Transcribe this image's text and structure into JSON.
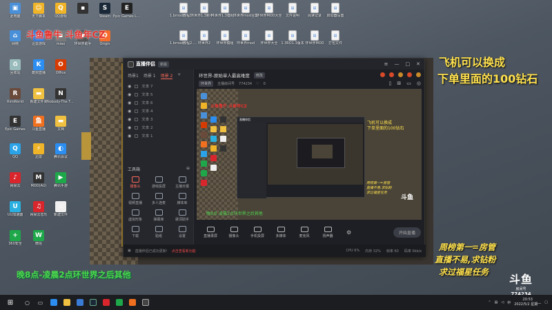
{
  "desktop_icons": [
    {
      "label": "此电脑",
      "color": "#4a90d9",
      "glyph": "▣"
    },
    {
      "label": "天下脚本",
      "color": "#f0b429",
      "glyph": "☺"
    },
    {
      "label": "QQ游戏",
      "color": "#f0b429",
      "glyph": "Q"
    },
    {
      "label": "",
      "color": "#333",
      "glyph": "▪"
    },
    {
      "label": "Steam",
      "color": "#1b2838",
      "glyph": "S"
    },
    {
      "label": "Epic Games Launcher",
      "color": "#222",
      "glyph": "E"
    },
    {
      "label": "网络",
      "color": "#4a90d9",
      "glyph": "⌂"
    },
    {
      "label": "迅雷游戏",
      "color": "#3a7bd5",
      "glyph": "▶"
    },
    {
      "label": "miao",
      "color": "#7a7a7a",
      "glyph": "▪"
    },
    {
      "label": "环世界助手",
      "color": "#555",
      "glyph": "▪"
    },
    {
      "label": "Origin",
      "color": "#f56c2d",
      "glyph": "O"
    },
    {
      "label": "回收站",
      "color": "#9bb",
      "glyph": "♻"
    },
    {
      "label": "酷狗直播",
      "color": "#2b8ef0",
      "glyph": "K"
    },
    {
      "label": "Office",
      "color": "#d83b01",
      "glyph": "O"
    },
    {
      "label": "RimWorld",
      "color": "#6a4a3a",
      "glyph": "R"
    },
    {
      "label": "新建文件夹",
      "color": "#f0c040",
      "glyph": "▬"
    },
    {
      "label": "Nobody-The Turn",
      "color": "#333",
      "glyph": "N"
    },
    {
      "label": "Epic Games",
      "color": "#333",
      "glyph": "E"
    },
    {
      "label": "斗鱼直播",
      "color": "#f07020",
      "glyph": "鱼"
    },
    {
      "label": "文档",
      "color": "#f0c040",
      "glyph": "▬"
    },
    {
      "label": "QQ",
      "color": "#2aa3e8",
      "glyph": "Q"
    },
    {
      "label": "迅雷",
      "color": "#f0b429",
      "glyph": "⚡"
    },
    {
      "label": "腾讯会议",
      "color": "#2b8ef0",
      "glyph": "◐"
    },
    {
      "label": "网易云",
      "color": "#d8262c",
      "glyph": "♪"
    },
    {
      "label": "MOD(AU)",
      "color": "#333",
      "glyph": "M"
    },
    {
      "label": "腾讯手游",
      "color": "#1ea84a",
      "glyph": "▶"
    },
    {
      "label": "UU加速器",
      "color": "#2ab0e0",
      "glyph": "U"
    },
    {
      "label": "网易云音乐",
      "color": "#d8262c",
      "glyph": "♫"
    },
    {
      "label": "新建文件",
      "color": "#f0f0f0",
      "glyph": "▫"
    },
    {
      "label": "360安全",
      "color": "#1ea84a",
      "glyph": "+"
    },
    {
      "label": "微信",
      "color": "#1ea84a",
      "glyph": "W"
    }
  ],
  "desktop_docs": [
    "1.bmod教程1.20",
    "环世界1.3新手入门",
    "环世界1.3模组汇总",
    "环世界mod合集",
    "环世界MOD大全",
    "文件说明",
    "阅读记录",
    "启动器设置",
    "1.bmod教程2.20",
    "环世界2",
    "环世界模组",
    "环世界mod",
    "环世界大全",
    "1.3RO1.3版本",
    "环世界MOD",
    "打包文件"
  ],
  "overlay": {
    "top_left_red": "斗鱼鲁牛  斗鱼年CZ",
    "right_line1": "飞机可以换成",
    "right_line2": "下单里面的100钻石",
    "right_bottom1": "周榜第一=房管",
    "right_bottom2": "直播不易,求钻粉",
    "right_bottom3": "求过福星任务",
    "bottom_green": "晚8点-凌晨2点环世界之后其他"
  },
  "watermark": {
    "logo": "斗鱼",
    "room_label": "房间号",
    "room_id": "774234"
  },
  "app": {
    "title": "直播伴侣",
    "version": "新版",
    "scene_tabs": [
      "场景1",
      "场景 1",
      "场景 2"
    ],
    "layers": [
      "文本 7",
      "文本 5",
      "文本 6",
      "文本 4",
      "文本 3",
      "文本 2",
      "文本 1"
    ],
    "tools_title": "工具箱",
    "tools": [
      {
        "label": "摄像头"
      },
      {
        "label": "游戏投屏"
      },
      {
        "label": "主播日报"
      },
      {
        "label": "视频直播"
      },
      {
        "label": "多人连麦"
      },
      {
        "label": "媒体库"
      },
      {
        "label": "虚拟形象"
      },
      {
        "label": "弹幕库"
      },
      {
        "label": "歌词助手"
      },
      {
        "label": "下载"
      },
      {
        "label": "贴纸"
      },
      {
        "label": "设置"
      }
    ],
    "room_title": "环世界-原始单人最高难度",
    "room_tag": "修改",
    "category": "环世界",
    "room_type_label": "主播房间号",
    "room_no": "774234",
    "likes": "0",
    "preview_red": "斗鱼鲁牛  斗鱼年CZ",
    "preview_yellow1": "飞机可以换成",
    "preview_yellow2": "下单里面的100钻石",
    "preview_green": "晚8点-凌晨2点环世界之后其他",
    "preview_right1": "周榜第一=房管",
    "preview_right2": "直播不易,求钻粉",
    "preview_right3": "求过福星任务",
    "preview_douyu": "斗鱼",
    "controls": [
      "直播录屏",
      "摄像头",
      "手机投屏",
      "多媒体",
      "麦克风",
      "扬声器"
    ],
    "start_button": "开始直播",
    "status_text": "直播伴侣已成功更新!",
    "status_hint": "点击查看新功能",
    "status_right": [
      "CPU 6%",
      "内存 32%",
      "帧率 60",
      "码率 0kb/s"
    ]
  },
  "taskbar": {
    "time": "20:53",
    "date": "2022/5/2 星期一",
    "lang": "中"
  }
}
